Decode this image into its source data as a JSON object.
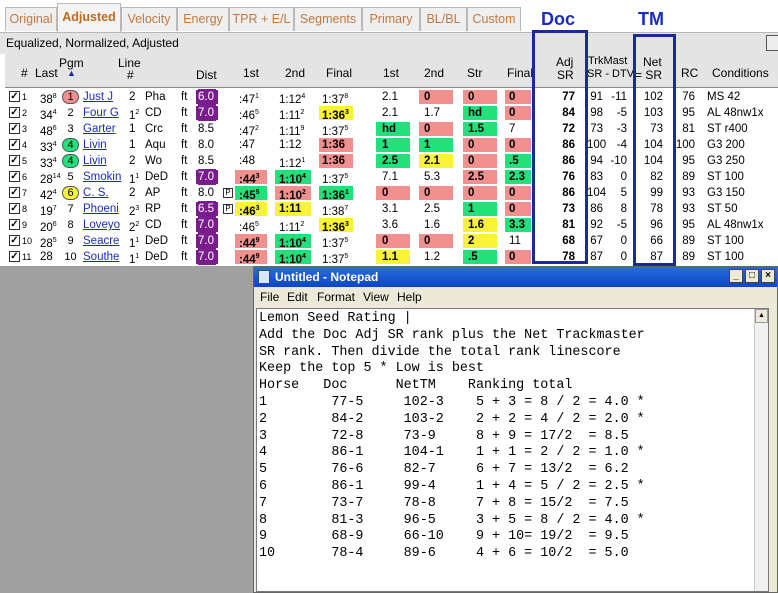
{
  "tabs": [
    "Original",
    "Adjusted",
    "Velocity",
    "Energy",
    "TPR + E/L",
    "Segments",
    "Primary",
    "BL/BL",
    "Custom"
  ],
  "active_tab": "Adjusted",
  "annotations": {
    "doc": "Doc",
    "tm": "TM"
  },
  "subtitle": "Equalized, Normalized, Adjusted",
  "headers": {
    "num": "#",
    "last": "Last",
    "pgm": "Pgm",
    "line": "Line",
    "line2": "#",
    "dist": "Dist",
    "c1st": "1st",
    "c2nd": "2nd",
    "cfinal": "Final",
    "p1st": "1st",
    "p2nd": "2nd",
    "str": "Str",
    "final": "Final",
    "adj": "Adj",
    "adj2": "SR",
    "trk": "TrkMast",
    "trk2": "SR - DTV",
    "net": "Net",
    "net2": "= SR",
    "rc": "RC",
    "cond": "Conditions"
  },
  "colors": {
    "green": "#22e07a",
    "red": "#f29090",
    "yellow": "#f8f23a",
    "purple": "#7a1d8c",
    "blue_annotation": "#1a2dbd"
  },
  "rows": [
    {
      "num": "1",
      "last": "38",
      "last_sup": "8",
      "pgm": "1",
      "horse": "Just J",
      "line": "2",
      "sup": "",
      "track": "Pha",
      "surf": "ft",
      "dist": "6.0",
      "c1": ":47",
      "c1s": "1",
      "c2": "1:12",
      "c2s": "4",
      "cf": "1:37",
      "cfs": "8",
      "p1": "2.1",
      "p2": "0",
      "str": "0",
      "fin": "0",
      "adj": "77",
      "trk": "91",
      "dtv": "-11",
      "net": "102",
      "rc": "76",
      "cond": "MS 42"
    },
    {
      "num": "2",
      "last": "34",
      "last_sup": "4",
      "pgm": "2",
      "horse": "Four G",
      "line": "1",
      "sup": "2",
      "track": "CD",
      "surf": "ft",
      "dist": "7.0",
      "c1": ":46",
      "c1s": "5",
      "c2": "1:11",
      "c2s": "2",
      "cf": "1:36",
      "cfs": "3",
      "p1": "2.1",
      "p2": "1.7",
      "str": "hd",
      "fin": "0",
      "adj": "84",
      "trk": "98",
      "dtv": "-5",
      "net": "103",
      "rc": "95",
      "cond": "AL 48nw1x"
    },
    {
      "num": "3",
      "last": "48",
      "last_sup": "6",
      "pgm": "3",
      "horse": "Garter",
      "line": "1",
      "sup": "",
      "track": "Crc",
      "surf": "ft",
      "dist": "8.5",
      "c1": ":47",
      "c1s": "2",
      "c2": "1:11",
      "c2s": "9",
      "cf": "1:37",
      "cfs": "5",
      "p1": "hd",
      "p2": "0",
      "str": "1.5",
      "fin": "7",
      "adj": "72",
      "trk": "73",
      "dtv": "-3",
      "net": "73",
      "rc": "81",
      "cond": "ST r400"
    },
    {
      "num": "4",
      "last": "33",
      "last_sup": "4",
      "pgm": "4",
      "horse": "Livin",
      "line": "1",
      "sup": "",
      "track": "Aqu",
      "surf": "ft",
      "dist": "8.0",
      "c1": ":47",
      "c1s": "",
      "c2": "1:12",
      "c2s": "",
      "cf": "1:36",
      "cfs": "",
      "p1": "1",
      "p2": "1",
      "str": "0",
      "fin": "0",
      "adj": "86",
      "trk": "100",
      "dtv": "-4",
      "net": "104",
      "rc": "100",
      "cond": "G3 200"
    },
    {
      "num": "5",
      "last": "33",
      "last_sup": "4",
      "pgm": "4",
      "horse": "Livin",
      "line": "2",
      "sup": "",
      "track": "Wo",
      "surf": "ft",
      "dist": "8.5",
      "c1": ":48",
      "c1s": "",
      "c2": "1:12",
      "c2s": "1",
      "cf": "1:36",
      "cfs": "",
      "p1": "2.5",
      "p2": "2.1",
      "str": "0",
      "fin": ".5",
      "adj": "86",
      "trk": "94",
      "dtv": "-10",
      "net": "104",
      "rc": "95",
      "cond": "G3 250"
    },
    {
      "num": "6",
      "last": "28",
      "last_sup": "14",
      "pgm": "5",
      "horse": "Smokin",
      "line": "1",
      "sup": "1",
      "track": "DeD",
      "surf": "ft",
      "dist": "7.0",
      "c1": ":44",
      "c1s": "3",
      "c2": "1:10",
      "c2s": "4",
      "cf": "1:37",
      "cfs": "5",
      "p1": "7.1",
      "p2": "5.3",
      "str": "2.5",
      "fin": "2.3",
      "adj": "76",
      "trk": "83",
      "dtv": "0",
      "net": "82",
      "rc": "89",
      "cond": "ST 100"
    },
    {
      "num": "7",
      "last": "42",
      "last_sup": "4",
      "pgm": "6",
      "horse": "C. S.",
      "line": "2",
      "sup": "",
      "track": "AP",
      "surf": "ft",
      "dist": "8.0",
      "c1": ":45",
      "c1s": "5",
      "c2": "1:10",
      "c2s": "2",
      "cf": "1:36",
      "cfs": "1",
      "p1": "0",
      "p2": "0",
      "str": "0",
      "fin": "0",
      "adj": "86",
      "trk": "104",
      "dtv": "5",
      "net": "99",
      "rc": "93",
      "cond": "G3 150"
    },
    {
      "num": "8",
      "last": "19",
      "last_sup": "7",
      "pgm": "7",
      "horse": "Phoeni",
      "line": "2",
      "sup": "3",
      "track": "RP",
      "surf": "ft",
      "dist": "6.5",
      "c1": ":46",
      "c1s": "3",
      "c2": "1:11",
      "c2s": "",
      "cf": "1:38",
      "cfs": "7",
      "p1": "3.1",
      "p2": "2.5",
      "str": "1",
      "fin": "0",
      "adj": "73",
      "trk": "86",
      "dtv": "8",
      "net": "78",
      "rc": "93",
      "cond": "ST 50"
    },
    {
      "num": "9",
      "last": "20",
      "last_sup": "6",
      "pgm": "8",
      "horse": "Loveyo",
      "line": "2",
      "sup": "2",
      "track": "CD",
      "surf": "ft",
      "dist": "7.0",
      "c1": ":46",
      "c1s": "5",
      "c2": "1:11",
      "c2s": "2",
      "cf": "1:36",
      "cfs": "3",
      "p1": "3.6",
      "p2": "1.6",
      "str": "1.6",
      "fin": "3.3",
      "adj": "81",
      "trk": "92",
      "dtv": "-5",
      "net": "96",
      "rc": "95",
      "cond": "AL 48nw1x"
    },
    {
      "num": "10",
      "last": "28",
      "last_sup": "5",
      "pgm": "9",
      "horse": "Seacre",
      "line": "1",
      "sup": "1",
      "track": "DeD",
      "surf": "ft",
      "dist": "7.0",
      "c1": ":44",
      "c1s": "9",
      "c2": "1:10",
      "c2s": "4",
      "cf": "1:37",
      "cfs": "5",
      "p1": "0",
      "p2": "0",
      "str": "2",
      "fin": "11",
      "adj": "68",
      "trk": "67",
      "dtv": "0",
      "net": "66",
      "rc": "89",
      "cond": "ST 100"
    },
    {
      "num": "11",
      "last": "28",
      "last_sup": "",
      "pgm": "10",
      "horse": "Southe",
      "line": "1",
      "sup": "1",
      "track": "DeD",
      "surf": "ft",
      "dist": "7.0",
      "c1": ":44",
      "c1s": "9",
      "c2": "1:10",
      "c2s": "4",
      "cf": "1:37",
      "cfs": "5",
      "p1": "1.1",
      "p2": "1.2",
      "str": ".5",
      "fin": "0",
      "adj": "78",
      "trk": "87",
      "dtv": "0",
      "net": "87",
      "rc": "89",
      "cond": "ST 100"
    }
  ],
  "notepad": {
    "title": "Untitled - Notepad",
    "menu": [
      "File",
      "Edit",
      "Format",
      "View",
      "Help"
    ],
    "controls": [
      "_",
      "□",
      "×"
    ],
    "text_lines": [
      "Lemon Seed Rating |",
      "Add the Doc Adj SR rank plus the Net Trackmaster",
      "SR rank. Then divide the total rank linescore",
      "Keep the top 5 * Low is best",
      "Horse   Doc      NetTM    Ranking total",
      "1        77-5     102-3    5 + 3 = 8 / 2 = 4.0 *",
      "2        84-2     103-2    2 + 2 = 4 / 2 = 2.0 *",
      "3        72-8     73-9     8 + 9 = 17/2  = 8.5",
      "4        86-1     104-1    1 + 1 = 2 / 2 = 1.0 *",
      "5        76-6     82-7     6 + 7 = 13/2  = 6.2",
      "6        86-1     99-4     1 + 4 = 5 / 2 = 2.5 *",
      "7        73-7     78-8     7 + 8 = 15/2  = 7.5",
      "8        81-3     96-5     3 + 5 = 8 / 2 = 4.0 *",
      "9        68-9     66-10    9 + 10= 19/2  = 9.5",
      "10       78-4     89-6     4 + 6 = 10/2  = 5.0"
    ]
  }
}
